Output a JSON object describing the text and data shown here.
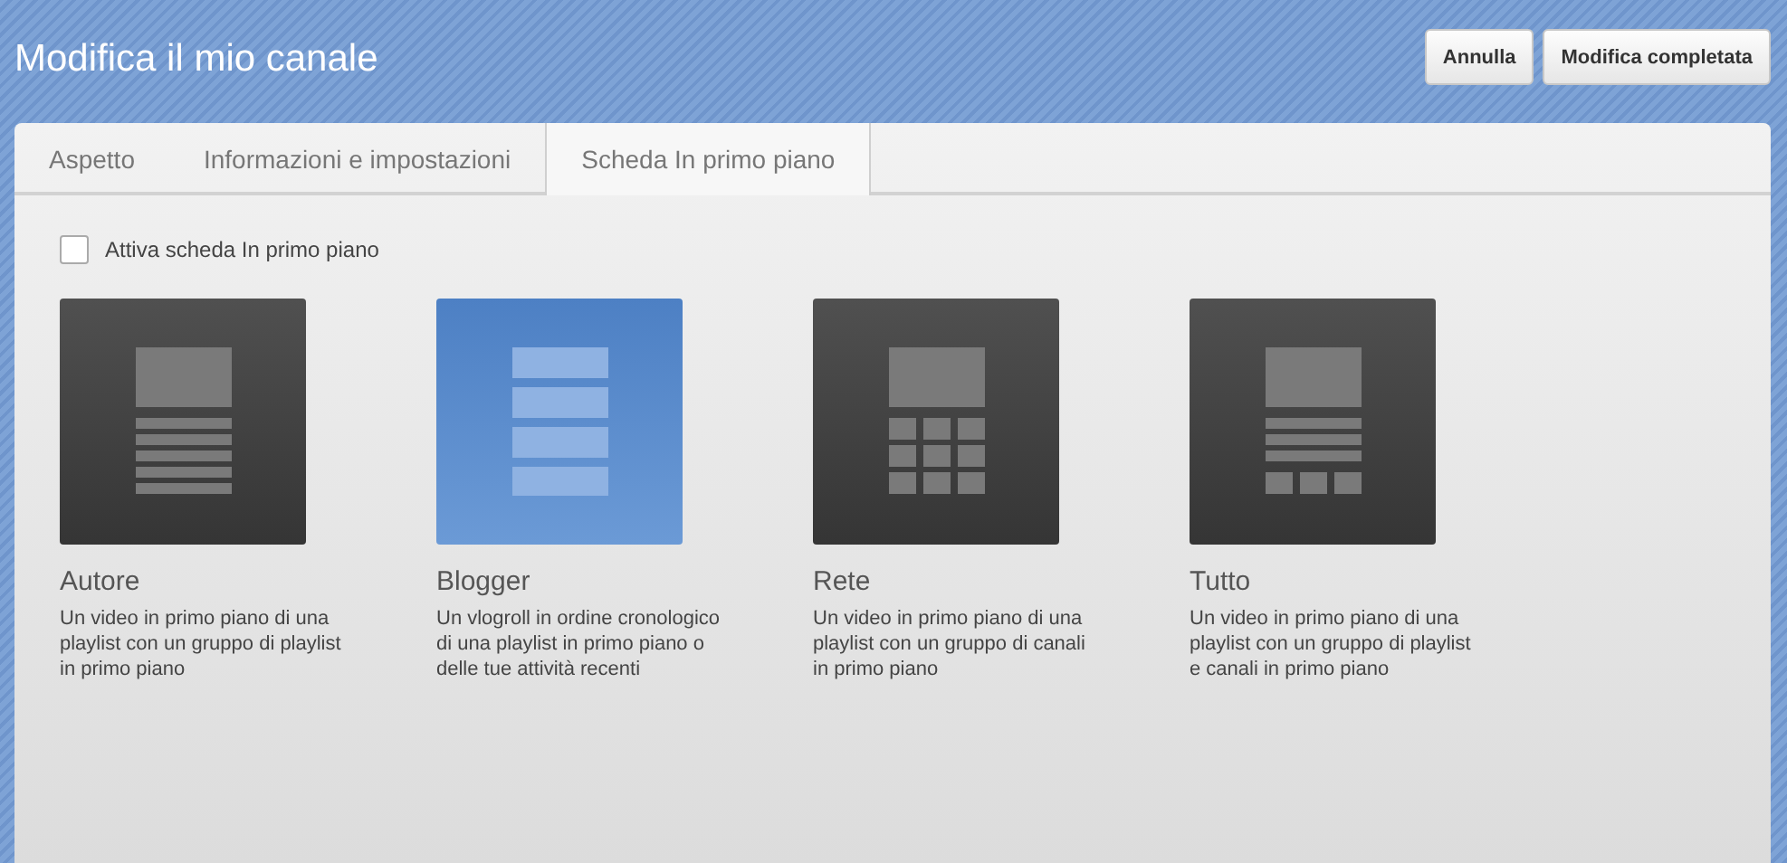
{
  "header": {
    "title": "Modifica il mio canale",
    "buttons": [
      "Annulla",
      "Modifica completata"
    ]
  },
  "tabs": [
    {
      "label": "Aspetto",
      "selected": false
    },
    {
      "label": "Informazioni e impostazioni",
      "selected": false
    },
    {
      "label": "Scheda In primo piano",
      "selected": true
    }
  ],
  "enable_checkbox": {
    "label": "Attiva scheda In primo piano",
    "checked": false
  },
  "layouts": [
    {
      "kind": "author",
      "name": "Autore",
      "description": "Un video in primo piano di una playlist con un gruppo di playlist in primo piano",
      "selected": false
    },
    {
      "kind": "blogger",
      "name": "Blogger",
      "description": "Un vlogroll in ordine cronologico di una playlist in primo piano o delle tue attività recenti",
      "selected": true
    },
    {
      "kind": "network",
      "name": "Rete",
      "description": "Un video in primo piano di una playlist con un gruppo di canali in primo piano",
      "selected": false
    },
    {
      "kind": "everything",
      "name": "Tutto",
      "description": "Un video in primo piano di una playlist con un gruppo di playlist e canali in primo piano",
      "selected": false
    }
  ]
}
